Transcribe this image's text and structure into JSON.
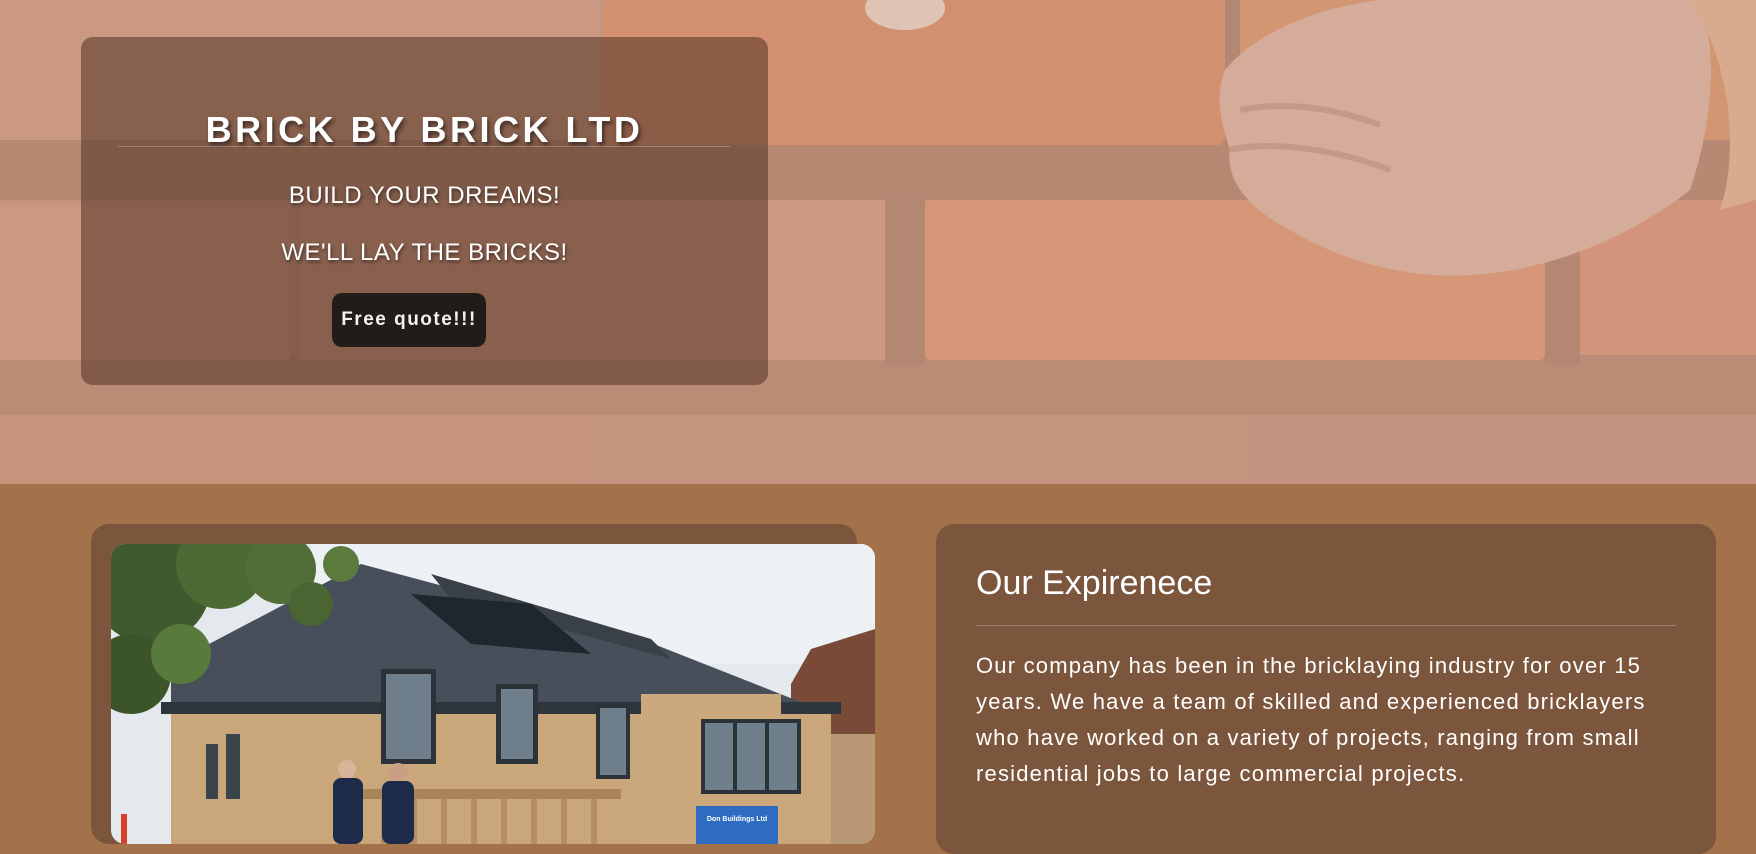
{
  "hero": {
    "title": "BRICK BY BRICK LTD",
    "tagline_1": "BUILD YOUR DREAMS!",
    "tagline_2": "WE'LL LAY THE BRICKS!",
    "cta_label": "Free quote!!!"
  },
  "experience": {
    "title": "Our Expirenece",
    "body": "Our company has been in the bricklaying industry for over 15 years. We have a team of skilled and experienced bricklayers who have worked on a variety of projects, ranging from small residential jobs to large commercial projects."
  },
  "photo": {
    "sign_text": "Don Buildings Ltd"
  },
  "colors": {
    "page_bg": "#a3724a",
    "card_bg": "#7c563c",
    "hero_overlay": "#c1907a",
    "button_bg": "#221c18"
  }
}
